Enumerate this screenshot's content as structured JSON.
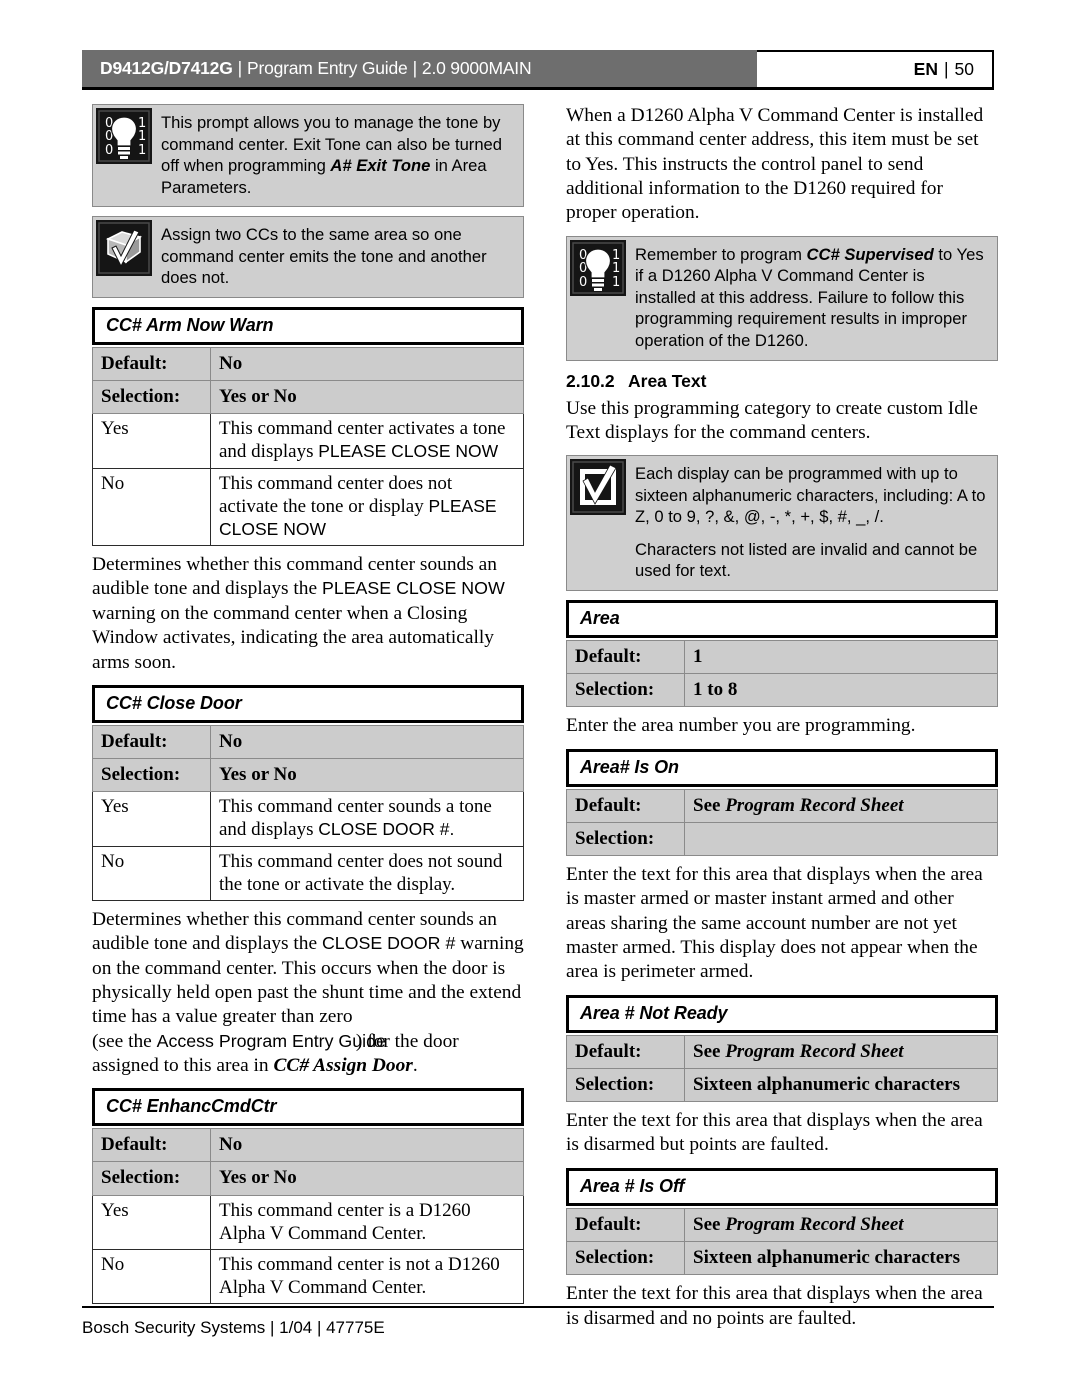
{
  "header": {
    "product": "D9412G/D7412G",
    "sep": "|",
    "guide": "Program Entry Guide",
    "version": "2.0  9000MAIN",
    "lang": "EN",
    "page": "50"
  },
  "footer": {
    "text": "Bosch Security Systems | 1/04 | 47775E"
  },
  "left_column": {
    "callout_tip": {
      "icon": "lightbulb-binary-icon",
      "text_1": "This prompt allows you to manage the",
      "text_2": "tone by command center. Exit Tone can",
      "text_3": "also be turned off when programming ",
      "bold_1": "A#",
      "bold_2": "Exit Tone",
      "text_4": " in Area Parameters."
    },
    "callout_note": {
      "icon": "box-checkmark-icon",
      "text": "Assign two CCs to the same area so one command center emits the tone and another does not."
    },
    "section_arm_now_warn": {
      "title": "CC# Arm Now Warn",
      "default_label": "Default:",
      "default_value": "No",
      "selection_label": "Selection:",
      "selection_value": "Yes or No",
      "rows": [
        {
          "key": "Yes",
          "text_a": "This command center activates a tone and displays ",
          "text_b": "PLEASE CLOSE NOW"
        },
        {
          "key": "No",
          "text_a": "This command center does not activate the tone or display ",
          "text_b": "PLEASE CLOSE NOW"
        }
      ],
      "paragraph_a": "Determines whether this command center sounds an audible tone and displays the ",
      "paragraph_b": "PLEASE CLOSE NOW",
      "paragraph_c": " warning on the command center when a Closing Window activates, indicating the area automatically arms soon."
    },
    "section_close_door": {
      "title": "CC# Close Door",
      "default_label": "Default:",
      "default_value": "No",
      "selection_label": "Selection:",
      "selection_value": "Yes or No",
      "rows": [
        {
          "key": "Yes",
          "text_a": "This command center sounds a tone and displays ",
          "text_b": "CLOSE DOOR #."
        },
        {
          "key": "No",
          "text_a": "This command center does not sound the tone or activate the display.",
          "text_b": ""
        }
      ],
      "paragraph_a": "Determines whether this command center sounds an audible tone and displays the ",
      "paragraph_b": "CLOSE DOOR #",
      "paragraph_c": " warning on the command center. This occurs when the door is physically held open past the shunt time and the extend time has a value greater than zero ",
      "paragraph_d": "(see the ",
      "paragraph_overlap_a": "Access Program Entry Guide",
      "paragraph_overlap_b": ") for the door",
      "paragraph_e": "assigned to this area in ",
      "paragraph_f": "CC# Assign Door",
      "paragraph_g": "."
    },
    "section_enhanc_cmd_ctr": {
      "title": "CC# EnhancCmdCtr",
      "default_label": "Default:",
      "default_value": "No",
      "selection_label": "Selection:",
      "selection_value": "Yes or No",
      "rows": [
        {
          "key": "Yes",
          "text_a": "This command center is a D1260 Alpha V Command Center.",
          "text_b": ""
        },
        {
          "key": "No",
          "text_a": "This command center is not a D1260 Alpha V Command Center.",
          "text_b": ""
        }
      ]
    }
  },
  "right_column": {
    "intro_paragraph": "When a D1260 Alpha V Command Center is installed at this command center address, this item must be set to Yes. This instructs the control panel to send additional information to the D1260 required for proper operation.",
    "callout_tip": {
      "icon": "lightbulb-binary-icon",
      "text_a": "Remember to program ",
      "bold": "CC# Supervised",
      "text_b": " to Yes if a D1260 Alpha V Command Center is installed at this address. Failure to follow this programming requirement results in improper operation of the D1260."
    },
    "subsection": {
      "number": "2.10.2",
      "title": "Area Text",
      "paragraph": "Use this programming category to create custom Idle Text displays for the command centers."
    },
    "callout_note": {
      "icon": "checkbox-checkmark-icon",
      "text_1": "Each display can be programmed with up to sixteen alphanumeric characters, including: A to Z, 0 to 9,  ?,  &, @,  -,  *,  +,  $,  #,  _,  /.",
      "text_2": "Characters not listed are invalid and cannot be used for text."
    },
    "section_area": {
      "title": "Area",
      "default_label": "Default:",
      "default_value": "1",
      "selection_label": "Selection:",
      "selection_value": "1 to 8",
      "paragraph": "Enter the area number you are programming."
    },
    "section_area_is_on": {
      "title": "Area# Is On",
      "default_label": "Default:",
      "default_value_pre": "See ",
      "default_value_italic": "Program Record Sheet",
      "selection_label": "Selection:",
      "selection_value": "",
      "paragraph": "Enter the text for this area that displays when the area is master armed or master instant armed and other areas sharing the same account number are not yet master armed. This display does not appear when the area is perimeter armed."
    },
    "section_area_not_ready": {
      "title": "Area # Not Ready",
      "default_label": "Default:",
      "default_value_pre": "See ",
      "default_value_italic": "Program Record Sheet",
      "selection_label": "Selection:",
      "selection_value": "Sixteen alphanumeric characters",
      "paragraph": "Enter the text for this area that displays when the area is disarmed but points are faulted."
    },
    "section_area_is_off": {
      "title": "Area # Is Off",
      "default_label": "Default:",
      "default_value_pre": "See ",
      "default_value_italic": "Program Record Sheet",
      "selection_label": "Selection:",
      "selection_value": "Sixteen alphanumeric characters",
      "paragraph": "Enter the text for this area that displays when the area is disarmed and no points are faulted."
    }
  },
  "colors": {
    "header_band": "#6e6e6e",
    "callout_bg": "#cfcfcf",
    "table_head_bg": "#cccccc",
    "icon_bg": "#151515"
  }
}
